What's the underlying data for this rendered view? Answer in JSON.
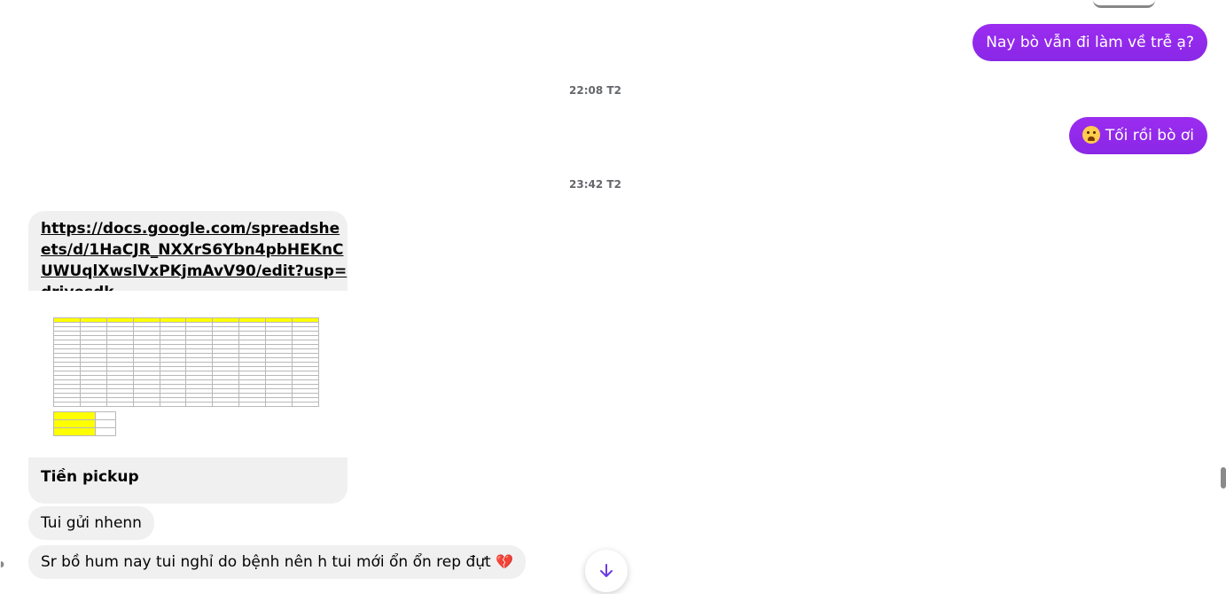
{
  "messages": {
    "out1": "Nay bò vẫn đi làm về trễ ạ?",
    "ts1": "22:08 T2",
    "out2": "Tối rồi bò ơi",
    "ts2": "23:42 T2",
    "link": "https://docs.google.com/spreadsheets/d/1HaCJR_NXXrS6Ybn4pbHEKnCUWUqlXwslVxPKjmAvV90/edit?usp=drivesdk",
    "link_title": "Tiền pickup",
    "in1": "Tui gửi nhenn",
    "in2": "Sr bồ hum nay tui nghỉ do bệnh nên h tui mới ổn ổn rep đựt"
  },
  "icons": {
    "emoji_out2": "fearful-face-icon",
    "broken_heart": "broken-heart-icon",
    "scroll_down": "arrow-down-icon"
  },
  "colors": {
    "outgoing_bubble": "#8a27e6",
    "incoming_bubble": "#f0f0f0",
    "sheet_header": "#ffff00"
  }
}
